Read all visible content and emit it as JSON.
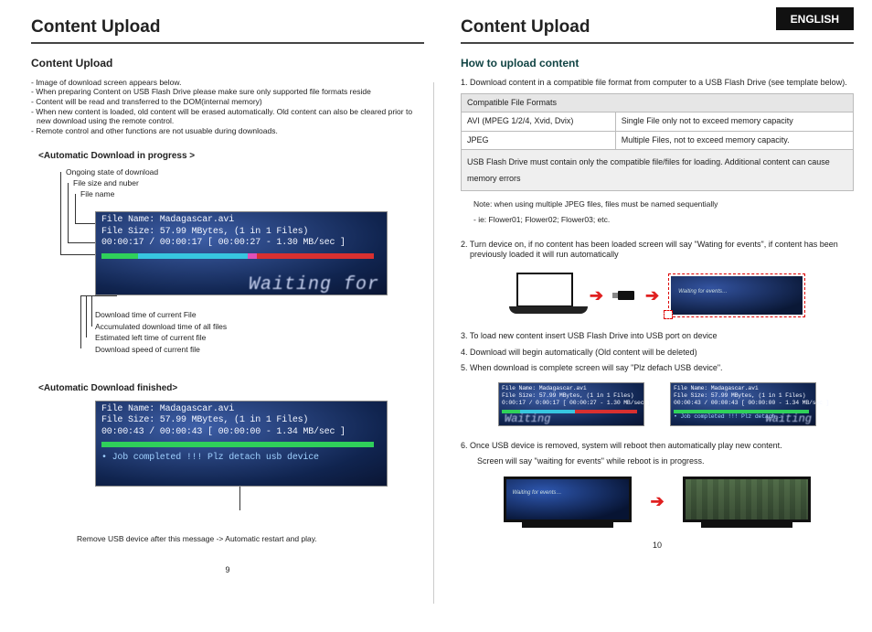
{
  "lang": "ENGLISH",
  "left": {
    "title": "Content Upload",
    "subtitle": "Content Upload",
    "notes": [
      "- Image of download screen appears below.",
      "- When preparing Content on USB Flash Drive please make sure only supported file formats reside",
      "- Content will be read and transferred to the DOM(internal memory)",
      "- When new content is loaded, old content will be erased automatically. Old content can also be cleared prior to new download using the remote control.",
      "- Remote control and other functions are not usuable during downloads."
    ],
    "auto_progress_label": "<Automatic Download in progress >",
    "callouts_top": [
      "Ongoing state of download",
      "File size and nuber",
      "File name"
    ],
    "screen1": {
      "line1": "File Name: Madagascar.avi",
      "line2": "File Size: 57.99 MBytes, (1 in 1 Files)",
      "line3": "00:00:17 / 00:00:17   [ 00:00:27 - 1.30 MB/sec ]",
      "waiting": "Waiting for"
    },
    "callouts_bottom": [
      "Download time of current File",
      "Accumulated download time of all files",
      "Estimated left time of current file",
      "Download speed of current file"
    ],
    "auto_finished_label": "<Automatic Download finished>",
    "screen2": {
      "line1": "File Name: Madagascar.avi",
      "line2": "File Size: 57.99 MBytes, (1 in 1 Files)",
      "line3": "00:00:43 / 00:00:43   [ 00:00:00 - 1.34 MB/sec ]",
      "line4": "• Job completed !!! Plz detach usb device"
    },
    "final_note": "Remove USB device after this message -> Automatic restart and play.",
    "page_num": "9"
  },
  "right": {
    "title": "Content Upload",
    "subtitle": "How to upload content",
    "step1": "1. Download content in a compatible file format from computer to a USB Flash Drive (see template below).",
    "table": {
      "header": "Compatible File Formats",
      "rows": [
        [
          "AVI (MPEG 1/2/4, Xvid, Dvix)",
          "Single File only not to exceed memory capacity"
        ],
        [
          "JPEG",
          "Multiple Files, not to exceed memory capacity."
        ]
      ],
      "note_row": "USB Flash Drive must contain only the compatible file/files for loading.  Additional content can cause memory errors"
    },
    "jpeg_note1": "Note: when using multiple JPEG files, files must be named sequentially",
    "jpeg_note2": "- ie: Flower01; Flower02; Flower03; etc.",
    "step2": "2. Turn device on, if no content has been loaded screen will say \"Wating for events\", if content has been previously loaded it will run automatically",
    "wide_screen_text": "Waiting for events…",
    "step3": "3. To load new content insert USB Flash Drive into USB port on device",
    "step4": "4. Download will begin automatically (Old content will be deleted)",
    "step5": "5. When download is complete screen will say \"Plz defach USB device\".",
    "mini_left": {
      "l1": "File Name: Madagascar.avi",
      "l2": "File Size: 57.99 MBytes, (1 in 1 Files)",
      "l3": "0:00:17 / 0:00:17   [ 00:00:27 - 1.30 MB/sec ]",
      "wait": "Waiting"
    },
    "mini_right": {
      "l1": "File Name: Madagascar.avi",
      "l2": "File Size: 57.99 MBytes, (1 in 1 Files)",
      "l3": "00:00:43 / 00:00:43   [ 00:00:00 - 1.34 MB/sec ]",
      "l4": "• Job completed !!! Plz detach …",
      "wait": "Waiting"
    },
    "step6a": "6. Once USB device is removed, system will reboot then automatically play new content.",
    "step6b": "Screen will say \"waiting for events\" while reboot is in progress.",
    "tv_text": "Waiting for events…",
    "page_num": "10"
  }
}
